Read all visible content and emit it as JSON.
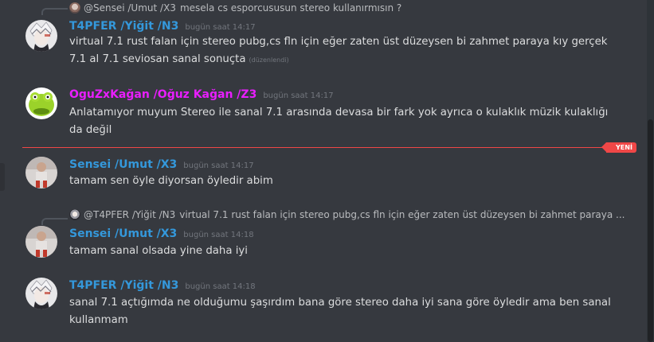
{
  "colors": {
    "background": "#36393f",
    "blue_name": "#3498db",
    "magenta_name": "#e91eff",
    "new_divider": "#f04747"
  },
  "top_reply": {
    "name": "@Sensei /Umut /X3",
    "text": "mesela cs esporcususun stereo kullanırmısın ?"
  },
  "messages": [
    {
      "author": "T4PFER /Yiğit /N3",
      "time": "bugün saat 14:17",
      "lines": [
        "virtual 7.1 rust falan için stereo pubg,cs fln için eğer zaten üst düzeysen bi zahmet paraya kıy gerçek",
        "7.1 al 7.1 seviosan sanal sonuçta"
      ],
      "edited": "(düzenlendi)"
    },
    {
      "author": "OguZxKağan /Oğuz Kağan /Z3",
      "time": "bugün saat 14:17",
      "lines": [
        "Anlatamıyor muyum Stereo ile sanal 7.1 arasında devasa bir fark yok ayrıca o kulaklık müzik kulaklığı",
        "da değil"
      ]
    },
    {
      "author": "Sensei /Umut /X3",
      "time": "bugün saat 14:17",
      "lines": [
        "tamam sen öyle diyorsan öyledir abim"
      ]
    },
    {
      "author": "Sensei /Umut /X3",
      "time": "bugün saat 14:18",
      "lines": [
        "tamam sanal olsada yine daha iyi"
      ],
      "reply": {
        "name": "@T4PFER /Yiğit /N3",
        "text": "virtual 7.1 rust falan için stereo pubg,cs fln için eğer zaten üst düzeysen bi zahmet paraya ..."
      }
    },
    {
      "author": "T4PFER /Yiğit /N3",
      "time": "bugün saat 14:18",
      "lines": [
        "sanal 7.1 açtığımda ne olduğumu şaşırdım bana göre stereo daha iyi sana göre öyledir ama ben sanal",
        "kullanmam"
      ]
    }
  ],
  "new_badge": "YENİ"
}
